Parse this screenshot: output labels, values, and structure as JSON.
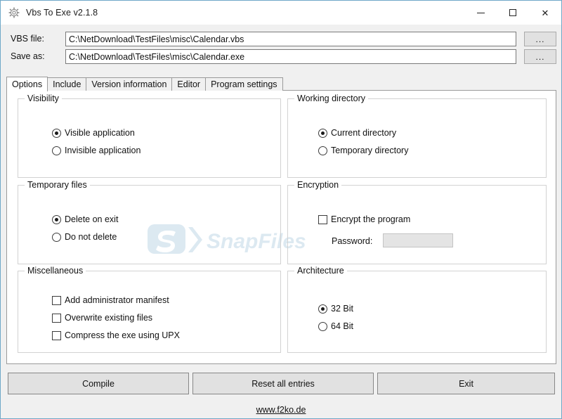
{
  "window": {
    "title": "Vbs To Exe v2.1.8",
    "icon": "gear-icon",
    "controls": {
      "minimize": "minimize-icon",
      "maximize": "maximize-icon",
      "close": "close-icon"
    },
    "accent_border": "#6fa8c8"
  },
  "file_fields": [
    {
      "label": "VBS file:",
      "value": "C:\\NetDownload\\TestFiles\\misc\\Calendar.vbs",
      "browse_label": "...",
      "placeholder": ""
    },
    {
      "label": "Save as:",
      "value": "C:\\NetDownload\\TestFiles\\misc\\Calendar.exe",
      "browse_label": "...",
      "placeholder": ""
    }
  ],
  "tabs": [
    {
      "label": "Options",
      "active": true
    },
    {
      "label": "Include",
      "active": false
    },
    {
      "label": "Version information",
      "active": false
    },
    {
      "label": "Editor",
      "active": false
    },
    {
      "label": "Program settings",
      "active": false
    }
  ],
  "groups": {
    "visibility": {
      "title": "Visibility",
      "options": [
        {
          "label": "Visible application",
          "checked": true
        },
        {
          "label": "Invisible application",
          "checked": false
        }
      ]
    },
    "working_directory": {
      "title": "Working directory",
      "options": [
        {
          "label": "Current directory",
          "checked": true
        },
        {
          "label": "Temporary directory",
          "checked": false
        }
      ]
    },
    "temporary_files": {
      "title": "Temporary files",
      "options": [
        {
          "label": "Delete on exit",
          "checked": true
        },
        {
          "label": "Do not delete",
          "checked": false
        }
      ]
    },
    "encryption": {
      "title": "Encryption",
      "checkbox": {
        "label": "Encrypt the program",
        "checked": false
      },
      "password_label": "Password:",
      "password_value": "",
      "password_placeholder": ""
    },
    "miscellaneous": {
      "title": "Miscellaneous",
      "options": [
        {
          "label": "Add administrator manifest",
          "checked": false
        },
        {
          "label": "Overwrite existing files",
          "checked": false
        },
        {
          "label": "Compress the exe using UPX",
          "checked": false
        }
      ]
    },
    "architecture": {
      "title": "Architecture",
      "options": [
        {
          "label": "32 Bit",
          "checked": true
        },
        {
          "label": "64 Bit",
          "checked": false
        }
      ]
    }
  },
  "buttons": {
    "compile": "Compile",
    "reset": "Reset all entries",
    "exit": "Exit"
  },
  "footer": {
    "link": "www.f2ko.de"
  },
  "watermark": {
    "text": "SnapFiles",
    "color": "#8fb7d4"
  }
}
